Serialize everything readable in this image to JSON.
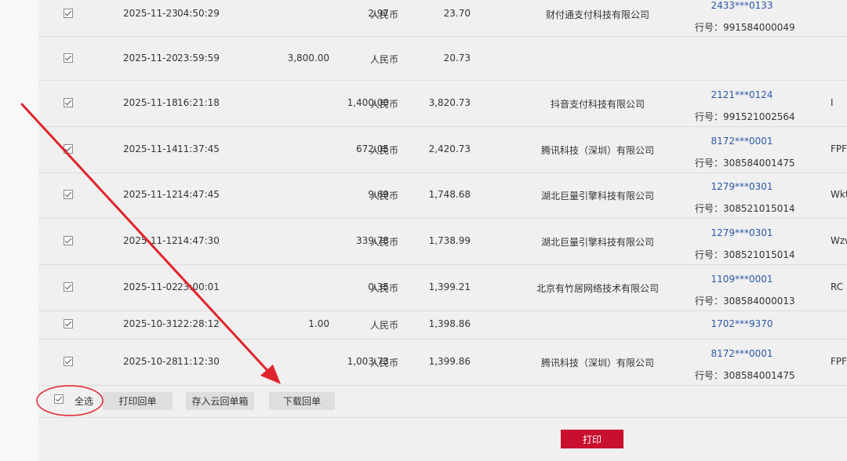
{
  "rows": [
    {
      "date": "2025-11-23",
      "time": "04:50:29",
      "credit": "",
      "debit": "2.97",
      "currency": "人民币",
      "balance": "23.70",
      "counterparty": "财付通支付科技有限公司",
      "account": "2433***0133",
      "bank_label": "行号：991584000049",
      "note": ""
    },
    {
      "date": "2025-11-20",
      "time": "23:59:59",
      "credit": "3,800.00",
      "debit": "",
      "currency": "人民币",
      "balance": "20.73",
      "counterparty": "",
      "account": "",
      "bank_label": "",
      "note": ""
    },
    {
      "date": "2025-11-18",
      "time": "16:21:18",
      "credit": "",
      "debit": "1,400.00",
      "currency": "人民币",
      "balance": "3,820.73",
      "counterparty": "抖音支付科技有限公司",
      "account": "2121***0124",
      "bank_label": "行号：991521002564",
      "note": "I"
    },
    {
      "date": "2025-11-14",
      "time": "11:37:45",
      "credit": "",
      "debit": "672.05",
      "currency": "人民币",
      "balance": "2,420.73",
      "counterparty": "腾讯科技（深圳）有限公司",
      "account": "8172***0001",
      "bank_label": "行号：308584001475",
      "note": "FPF"
    },
    {
      "date": "2025-11-12",
      "time": "14:47:45",
      "credit": "",
      "debit": "9.69",
      "currency": "人民币",
      "balance": "1,748.68",
      "counterparty": "湖北巨量引擎科技有限公司",
      "account": "1279***0301",
      "bank_label": "行号：308521015014",
      "note": "Wkt"
    },
    {
      "date": "2025-11-12",
      "time": "14:47:30",
      "credit": "",
      "debit": "339.78",
      "currency": "人民币",
      "balance": "1,738.99",
      "counterparty": "湖北巨量引擎科技有限公司",
      "account": "1279***0301",
      "bank_label": "行号：308521015014",
      "note": "Wzw"
    },
    {
      "date": "2025-11-02",
      "time": "23:00:01",
      "credit": "",
      "debit": "0.35",
      "currency": "人民币",
      "balance": "1,399.21",
      "counterparty": "北京有竹居网络技术有限公司",
      "account": "1109***0001",
      "bank_label": "行号：308584000013",
      "note": "RC"
    },
    {
      "date": "2025-10-31",
      "time": "22:28:12",
      "credit": "1.00",
      "debit": "",
      "currency": "人民币",
      "balance": "1,398.86",
      "counterparty": "",
      "account": "1702***9370",
      "bank_label": "",
      "note": ""
    },
    {
      "date": "2025-10-28",
      "time": "11:12:30",
      "credit": "",
      "debit": "1,003.73",
      "currency": "人民币",
      "balance": "1,399.86",
      "counterparty": "腾讯科技（深圳）有限公司",
      "account": "8172***0001",
      "bank_label": "行号：308584001475",
      "note": "FPF"
    }
  ],
  "footer": {
    "select_all_label": "全选",
    "print_receipt_label": "打印回单",
    "save_cloud_label": "存入云回单箱",
    "download_receipt_label": "下载回单",
    "print_label": "打印"
  },
  "colors": {
    "accent_red": "#c8102e",
    "link_blue": "#2b57a8",
    "annotation_red": "#e0242c"
  }
}
